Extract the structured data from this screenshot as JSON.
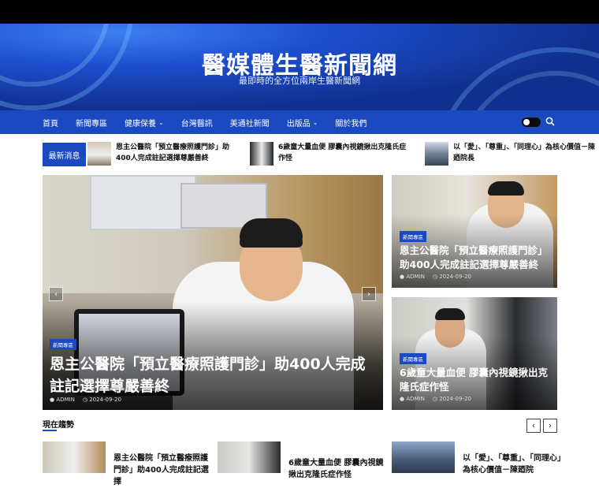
{
  "site": {
    "title": "醫媒體生醫新聞網",
    "subtitle": "最即時的全方位兩岸生醫新聞網"
  },
  "nav": {
    "items": [
      {
        "label": "首頁",
        "has_dropdown": false
      },
      {
        "label": "新聞專區",
        "has_dropdown": false
      },
      {
        "label": "健康保養",
        "has_dropdown": true
      },
      {
        "label": "台灣醫訊",
        "has_dropdown": false
      },
      {
        "label": "美通社新聞",
        "has_dropdown": false
      },
      {
        "label": "出版品",
        "has_dropdown": true
      },
      {
        "label": "關於我們",
        "has_dropdown": false
      }
    ],
    "dark_mode_icon": "toggle-icon",
    "search_icon": "search-icon"
  },
  "ticker": {
    "label": "最新消息",
    "items": [
      {
        "text": "恩主公醫院「預立醫療照護門診」助400人完成註記選擇尊嚴善終"
      },
      {
        "text": "6歲童大量血便 膠囊內視鏡揪出克隆氏症作怪"
      },
      {
        "text": "以「愛」、「尊重」、「同理心」為核心價值－陳廼院長"
      }
    ]
  },
  "hero": {
    "category": "新聞專區",
    "title": "恩主公醫院「預立醫療照護門診」助400人完成註記選擇尊嚴善終",
    "author": "ADMIN",
    "date": "2024-09-20",
    "prev_label": "‹",
    "next_label": "›"
  },
  "side_cards": [
    {
      "category": "新聞專區",
      "title": "恩主公醫院「預立醫療照護門診」助400人完成註記選擇尊嚴善終",
      "author": "ADMIN",
      "date": "2024-09-20"
    },
    {
      "category": "新聞專區",
      "title": "6歲童大量血便 膠囊內視鏡揪出克隆氏症作怪",
      "author": "ADMIN",
      "date": "2024-09-20"
    }
  ],
  "trending": {
    "heading": "現在趨勢",
    "prev_label": "‹",
    "next_label": "›",
    "items": [
      {
        "text": "恩主公醫院「預立醫療照護門診」助400人完成註記選擇"
      },
      {
        "text": "6歲童大量血便 膠囊內視鏡揪出克隆氏症作怪"
      },
      {
        "text": "以「愛」、「尊重」、「同理心」為核心價值－陳廼院"
      }
    ]
  },
  "colors": {
    "brand_blue": "#1b49c2",
    "topbar": "#000000"
  }
}
